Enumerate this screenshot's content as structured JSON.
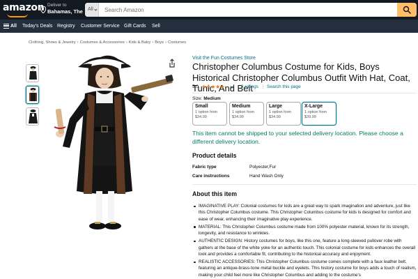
{
  "header": {
    "logo_text": "amazon",
    "deliver_line1": "Deliver to",
    "deliver_line2": "Bahamas, The",
    "search_category": "All",
    "search_placeholder": "Search Amazon"
  },
  "nav": {
    "all_label": "All",
    "items": [
      "Today's Deals",
      "Registry",
      "Customer Service",
      "Gift Cards",
      "Sell"
    ]
  },
  "breadcrumb": [
    "Clothing, Shoes & Jewelry",
    "Costumes & Accessories",
    "Kids & Baby",
    "Boys",
    "Costumes"
  ],
  "product": {
    "store_link": "Visit the Fun Costumes Store",
    "title": "Christopher Columbus Costume for Kids, Boys Historical Christopher Columbus Outfit With Hat, Coat, Tunic, And Belt",
    "rating_value": "5.0",
    "stars": "★★★★★",
    "ratings_count": "3 ratings",
    "search_page": "Search this page",
    "size_label": "Size:",
    "size_selected": "Medium",
    "sizes": [
      {
        "name": "Small",
        "option": "1 option from",
        "price": "$34.99"
      },
      {
        "name": "Medium",
        "option": "1 option from",
        "price": "$34.99"
      },
      {
        "name": "Large",
        "option": "1 option from",
        "price": "$34.99"
      },
      {
        "name": "X-Large",
        "option": "1 option from",
        "price": "$39.99"
      }
    ],
    "shipping_message": "This item cannot be shipped to your selected delivery location. Please choose a different delivery location.",
    "details_heading": "Product details",
    "details": [
      {
        "key": "Fabric type",
        "value": "Polyester,Fur"
      },
      {
        "key": "Care instructions",
        "value": "Hand Wash Only"
      }
    ],
    "about_heading": "About this item",
    "about": [
      "IMAGINATIVE PLAY: Colonial costumes for kids are a great way to spark imagination and adventure, just like this Christopher Columbus costume. This Christopher Columbus costume for kids is designed for comfort and ease of wear, enhancing their imaginative play experience.",
      "MATERIAL: This Christopher Columbus costume made from 100% polyester material, known for its strength, longevity, and resistance to wrinkles.",
      "AUTHENTIC DESIGN: History costumes for boys, like this one, feature a long-sleeved pullover robe with gathers at the base of the white yoke for an authentic touch. This colonial costume for kids enhances the overall look and provides a comfortable fit, contributing to the historical accuracy and enjoyment.",
      "REALISTIC ACCESSORIES: This Christopher Columbus costume comes complete with a faux leather belt, featuring an antique-brass-tone metal buckle and eyelets. This history costume for boys adds a touch of realism, making your child feel more like Christopher Columbus and adding to the costume's"
    ]
  },
  "colors": {
    "nav_dark": "#131921",
    "nav_secondary": "#232f3e",
    "search_button": "#febd69",
    "link": "#007185",
    "star": "#de7921",
    "shipping_green": "#067d62"
  }
}
